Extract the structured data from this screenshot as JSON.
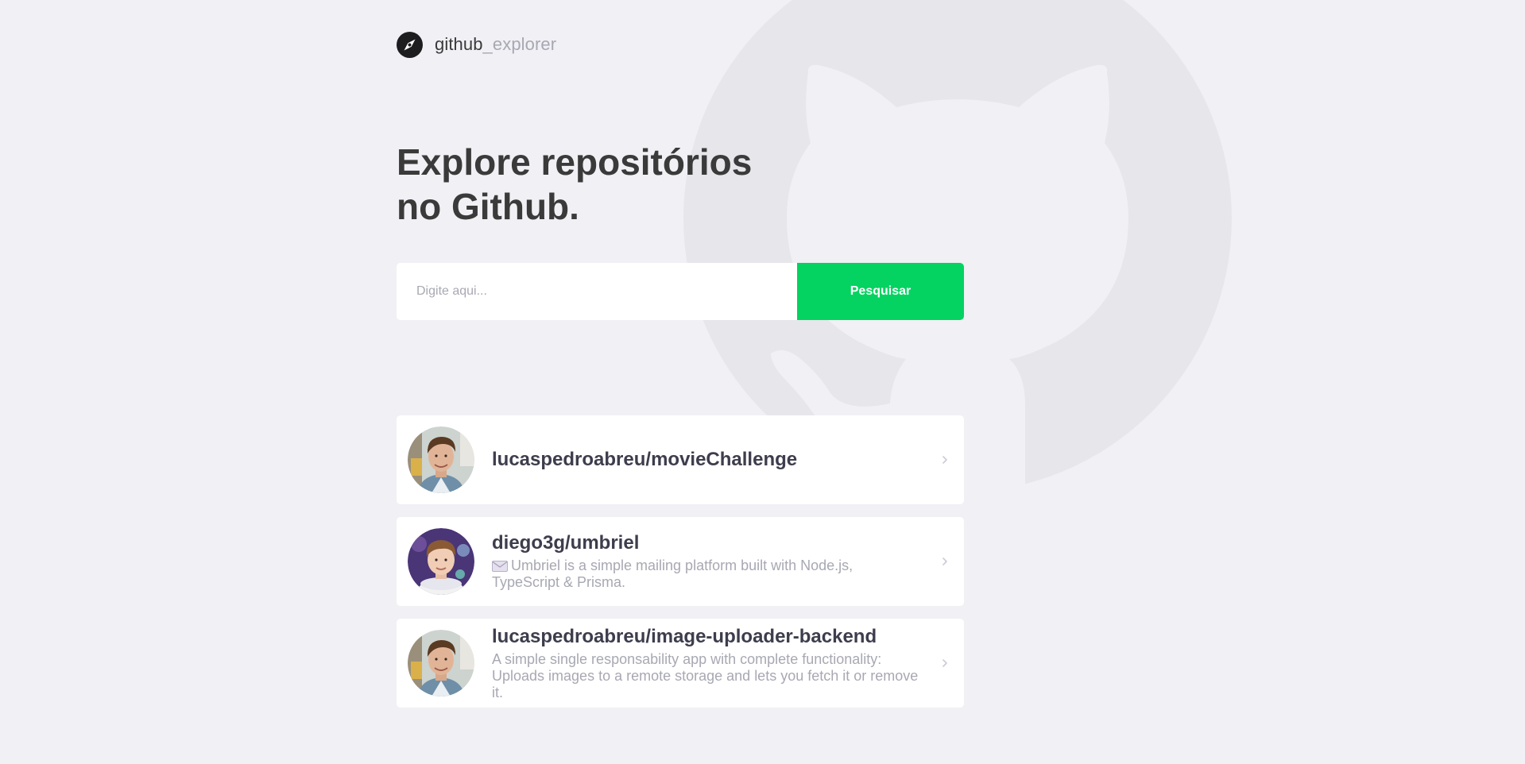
{
  "brand": {
    "name_main": "github",
    "name_accent": "_explorer",
    "icon": "compass-icon"
  },
  "hero": {
    "title_line1": "Explore repositórios",
    "title_line2": "no Github."
  },
  "search": {
    "placeholder": "Digite aqui...",
    "value": "",
    "button_label": "Pesquisar"
  },
  "repositories": [
    {
      "full_name": "lucaspedroabreu/movieChallenge",
      "description": "",
      "avatar": "avatar-lucaspedroabreu"
    },
    {
      "full_name": "diego3g/umbriel",
      "description": "Umbriel is a simple mailing platform built with Node.js, TypeScript & Prisma.",
      "description_icon": "envelope-icon",
      "avatar": "avatar-diego3g"
    },
    {
      "full_name": "lucaspedroabreu/image-uploader-backend",
      "description": "A simple single responsability app with complete functionality: Uploads images to a remote storage and lets you fetch it or remove it.",
      "avatar": "avatar-lucaspedroabreu"
    }
  ],
  "colors": {
    "background": "#f0f0f5",
    "accent_green": "#04d361",
    "title_text": "#3a3a3a",
    "muted_text": "#a8a8b3",
    "card_bg": "#ffffff"
  }
}
